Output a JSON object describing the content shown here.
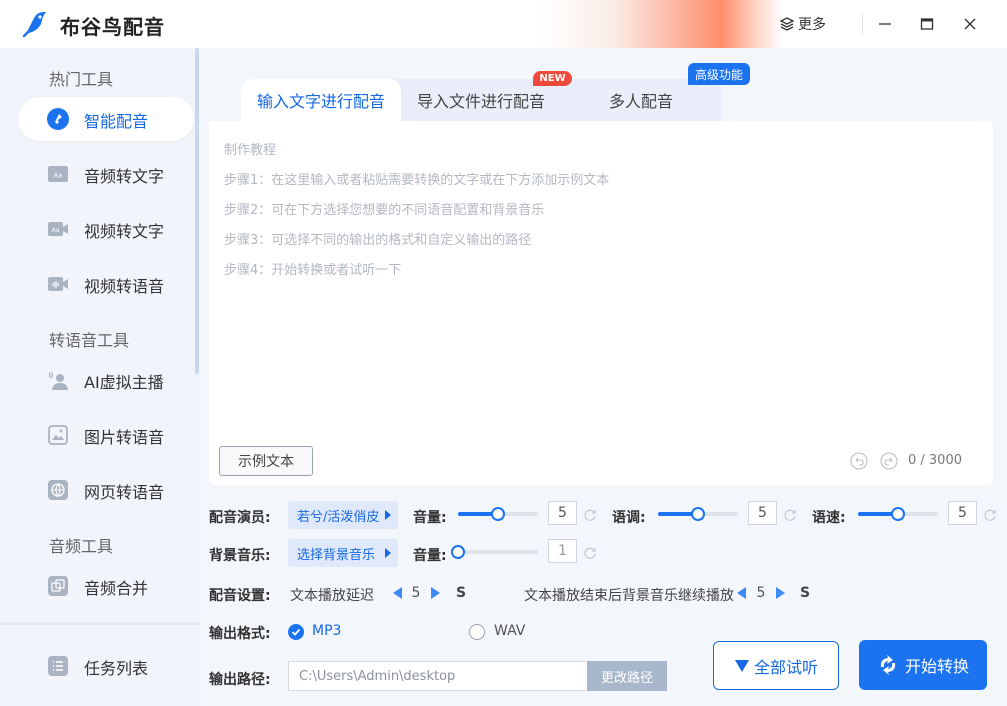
{
  "app": {
    "title": "布谷鸟配音"
  },
  "titlebar": {
    "more_label": "更多"
  },
  "sidebar": {
    "sections": [
      "热门工具",
      "转语音工具",
      "音频工具"
    ],
    "items": [
      {
        "label": "智能配音",
        "icon": "smart-dub-icon",
        "active": true
      },
      {
        "label": "音频转文字",
        "icon": "audio-to-text-icon"
      },
      {
        "label": "视频转文字",
        "icon": "video-to-text-icon"
      },
      {
        "label": "视频转语音",
        "icon": "video-to-voice-icon"
      },
      {
        "label": "AI虚拟主播",
        "icon": "ai-anchor-icon"
      },
      {
        "label": "图片转语音",
        "icon": "image-to-voice-icon"
      },
      {
        "label": "网页转语音",
        "icon": "web-to-voice-icon"
      },
      {
        "label": "音频合并",
        "icon": "audio-merge-icon"
      },
      {
        "label": "任务列表",
        "icon": "task-list-icon"
      }
    ]
  },
  "tabs": [
    {
      "label": "输入文字进行配音",
      "active": true
    },
    {
      "label": "导入文件进行配音"
    },
    {
      "label": "多人配音"
    }
  ],
  "badges": {
    "new": "NEW",
    "advanced": "高级功能"
  },
  "editor": {
    "heading": "制作教程",
    "steps": [
      "步骤1：在这里输入或者粘贴需要转换的文字或在下方添加示例文本",
      "步骤2：可在下方选择您想要的不同语音配置和背景音乐",
      "步骤3：可选择不同的输出的格式和自定义输出的路径",
      "步骤4：开始转换或者试听一下"
    ],
    "sample_button": "示例文本",
    "char_count": "0 / 3000"
  },
  "settings": {
    "voice_label": "配音演员:",
    "voice_value": "若兮/活泼俏皮",
    "bgm_label": "背景音乐:",
    "bgm_value": "选择背景音乐",
    "volume_label": "音量:",
    "pitch_label": "语调:",
    "speed_label": "语速:",
    "volume_value": "5",
    "pitch_value": "5",
    "speed_value": "5",
    "bgm_volume_value": "1",
    "volume_level": 0.5,
    "pitch_level": 0.5,
    "speed_level": 0.5,
    "bgm_volume_level": 0.0,
    "dub_settings_label": "配音设置:",
    "delay_label": "文本播放延迟",
    "delay_value": "5",
    "delay_unit": "S",
    "bgm_continue_label": "文本播放结束后背景音乐继续播放",
    "bgm_continue_value": "5",
    "bgm_continue_unit": "S",
    "format_label": "输出格式:",
    "format_options": [
      {
        "label": "MP3",
        "selected": true
      },
      {
        "label": "WAV",
        "selected": false
      }
    ],
    "path_label": "输出路径:",
    "path_value": "C:\\Users\\Admin\\desktop",
    "path_button": "更改路径"
  },
  "actions": {
    "preview_all": "全部试听",
    "start": "开始转换"
  },
  "colors": {
    "accent": "#1b73f0",
    "new_badge": "#ef4b3c",
    "sidebar_bg": "#f1f4fa"
  }
}
